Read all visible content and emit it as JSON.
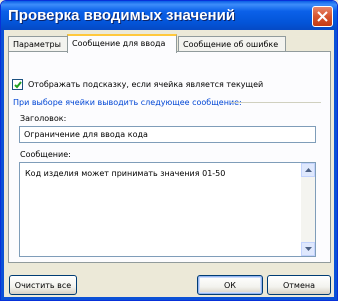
{
  "window": {
    "title": "Проверка вводимых значений"
  },
  "tabs": [
    {
      "label": "Параметры",
      "active": false
    },
    {
      "label": "Сообщение для ввода",
      "active": true
    },
    {
      "label": "Сообщение об ошибке",
      "active": false
    }
  ],
  "input_message": {
    "show_checkbox_label": "Отображать подсказку, если ячейка является текущей",
    "show_checkbox_checked": true,
    "group_label": "При выборе ячейки выводить следующее сообщение:",
    "title_label": "Заголовок:",
    "title_value": "Ограничение для ввода кода",
    "message_label": "Сообщение:",
    "message_value": "Код изделия может принимать значения 01-50"
  },
  "buttons": {
    "clear_all": "Очистить все",
    "ok": "ОК",
    "cancel": "Отмена"
  }
}
